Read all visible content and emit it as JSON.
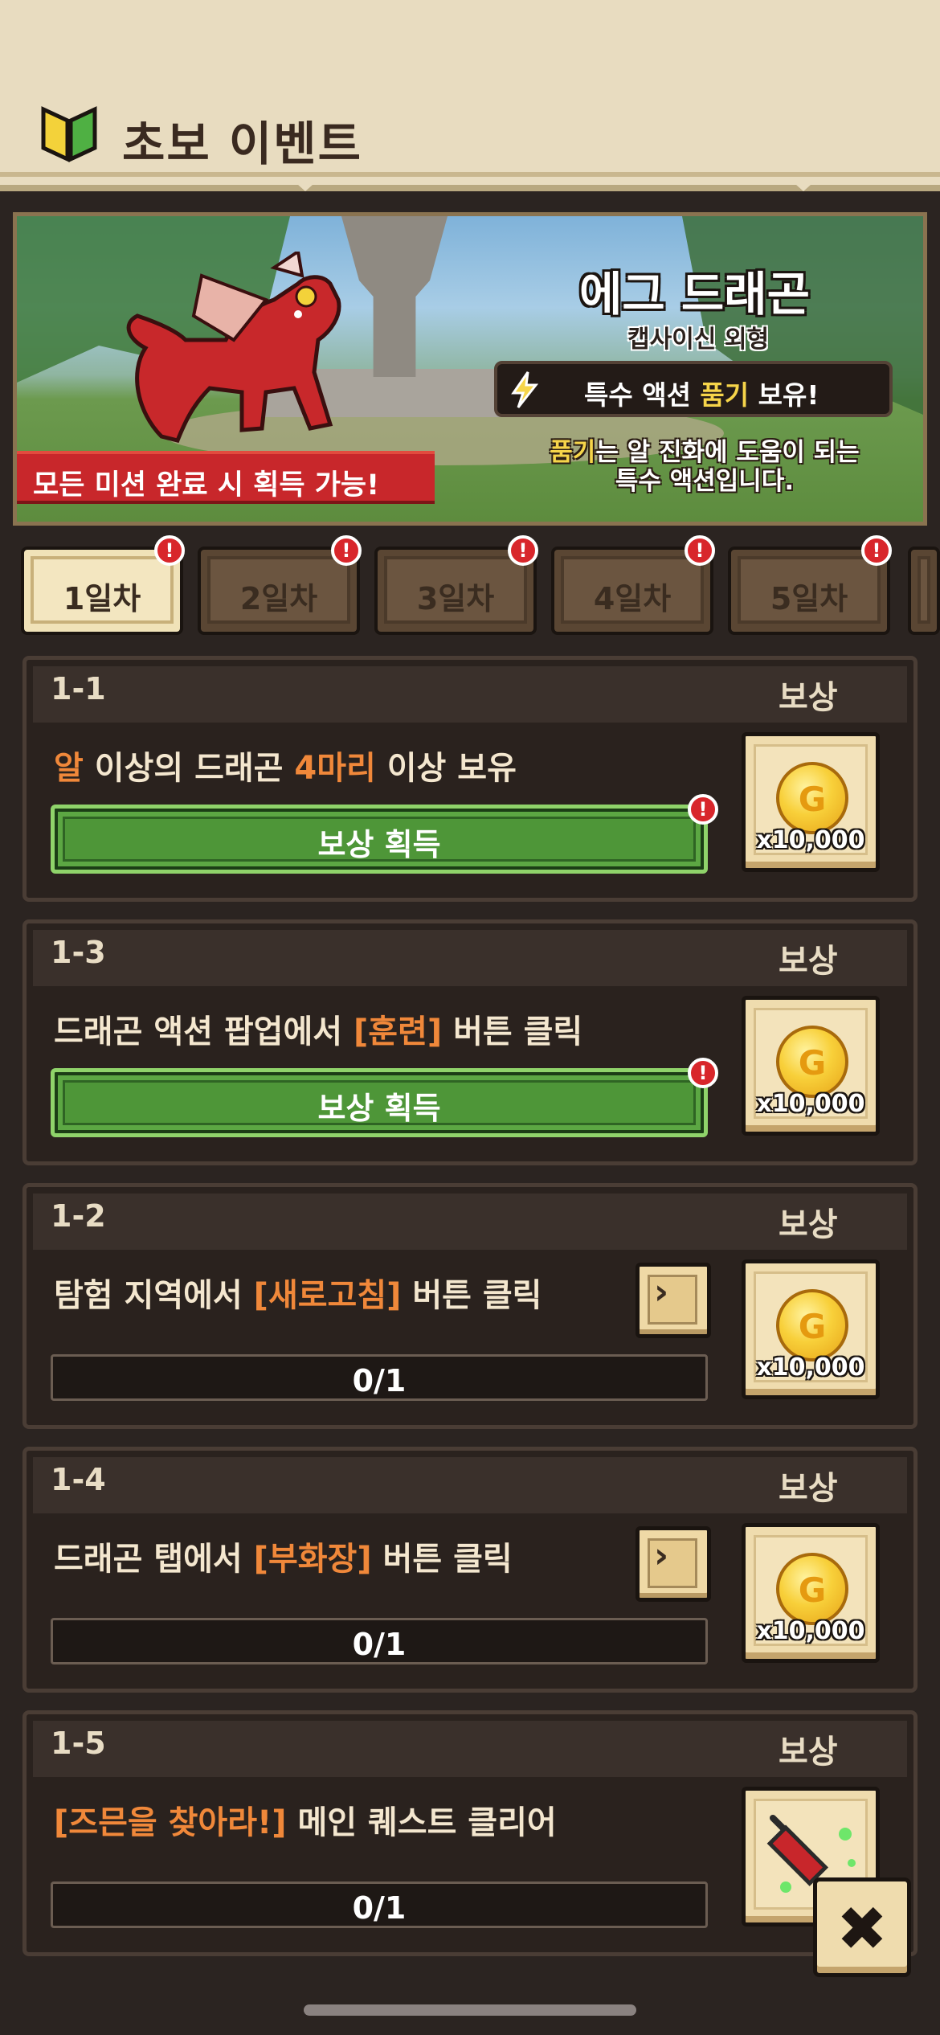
{
  "header": {
    "title": "초보 이벤트",
    "icon": "beginner-leaf-icon"
  },
  "banner": {
    "title": "에그 드래곤",
    "subtitle": "캡사이신 외형",
    "special_prefix": "특수 액션 ",
    "special_highlight": "품기",
    "special_suffix": " 보유!",
    "desc_highlight": "품기",
    "desc_line1_rest": "는 알 진화에 도움이 되는",
    "desc_line2": "특수 액션입니다.",
    "ribbon": "모든 미션 완료 시 획득 가능!"
  },
  "tabs": [
    {
      "label": "1일차",
      "active": true,
      "alert": "!"
    },
    {
      "label": "2일차",
      "active": false,
      "alert": "!"
    },
    {
      "label": "3일차",
      "active": false,
      "alert": "!"
    },
    {
      "label": "4일차",
      "active": false,
      "alert": "!"
    },
    {
      "label": "5일차",
      "active": false,
      "alert": "!"
    }
  ],
  "missions": [
    {
      "id": "1-1",
      "reward_label": "보상",
      "desc": [
        {
          "text": "알",
          "hl": true
        },
        {
          "text": " 이상의 드래곤 ",
          "hl": false
        },
        {
          "text": "4마리",
          "hl": true
        },
        {
          "text": " 이상 보유",
          "hl": false
        }
      ],
      "action": "claim",
      "claim_label": "보상 획득",
      "alert": "!",
      "reward": {
        "type": "coin",
        "glyph": "G",
        "qty": "x10,000"
      }
    },
    {
      "id": "1-3",
      "reward_label": "보상",
      "desc": [
        {
          "text": "드래곤 액션 팝업에서 ",
          "hl": false
        },
        {
          "text": "[훈련]",
          "hl": true
        },
        {
          "text": " 버튼 클릭",
          "hl": false
        }
      ],
      "action": "claim",
      "claim_label": "보상 획득",
      "alert": "!",
      "reward": {
        "type": "coin",
        "glyph": "G",
        "qty": "x10,000"
      }
    },
    {
      "id": "1-2",
      "reward_label": "보상",
      "desc": [
        {
          "text": "탐험 지역에서 ",
          "hl": false
        },
        {
          "text": "[새로고침]",
          "hl": true
        },
        {
          "text": " 버튼 클릭",
          "hl": false
        }
      ],
      "action": "progress",
      "progress": "0/1",
      "progress_fraction": 0,
      "reward": {
        "type": "coin",
        "glyph": "G",
        "qty": "x10,000"
      }
    },
    {
      "id": "1-4",
      "reward_label": "보상",
      "desc": [
        {
          "text": "드래곤 탭에서 ",
          "hl": false
        },
        {
          "text": "[부화장]",
          "hl": true
        },
        {
          "text": " 버튼 클릭",
          "hl": false
        }
      ],
      "action": "progress",
      "progress": "0/1",
      "progress_fraction": 0,
      "reward": {
        "type": "coin",
        "glyph": "G",
        "qty": "x10,000"
      }
    },
    {
      "id": "1-5",
      "reward_label": "보상",
      "desc": [
        {
          "text": "[즈믄을 찾아라!]",
          "hl": true
        },
        {
          "text": " 메인 퀘스트 클리어",
          "hl": false
        }
      ],
      "action": "progress-nogo",
      "progress": "0/1",
      "progress_fraction": 0,
      "reward": {
        "type": "syringe"
      }
    }
  ],
  "close_icon": "close-x-icon",
  "colors": {
    "highlight": "#f0883a",
    "claim_green": "#5ca743",
    "alert_red": "#d8262b"
  }
}
